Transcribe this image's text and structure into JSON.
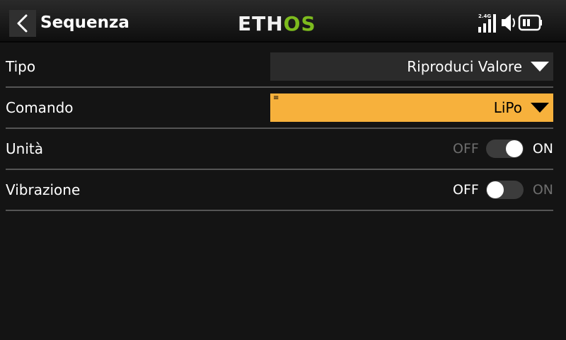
{
  "header": {
    "title": "Sequenza",
    "logo_left": "ETH",
    "logo_right": "OS",
    "rf_band": "2.4G",
    "icons": [
      "back-arrow-icon",
      "signal-bars-icon",
      "speaker-icon",
      "battery-icon"
    ]
  },
  "rows": [
    {
      "label": "Tipo",
      "kind": "dropdown",
      "value": "Riproduci Valore",
      "active": false
    },
    {
      "label": "Comando",
      "kind": "dropdown",
      "value": "LiPo",
      "active": true
    },
    {
      "label": "Unità",
      "kind": "toggle",
      "off_label": "OFF",
      "on_label": "ON",
      "state": true
    },
    {
      "label": "Vibrazione",
      "kind": "toggle",
      "off_label": "OFF",
      "on_label": "ON",
      "state": false
    }
  ],
  "colors": {
    "accent": "#F7B13C",
    "logo_green": "#7DBB1E",
    "background": "#141414",
    "field": "#2B2B2B"
  }
}
